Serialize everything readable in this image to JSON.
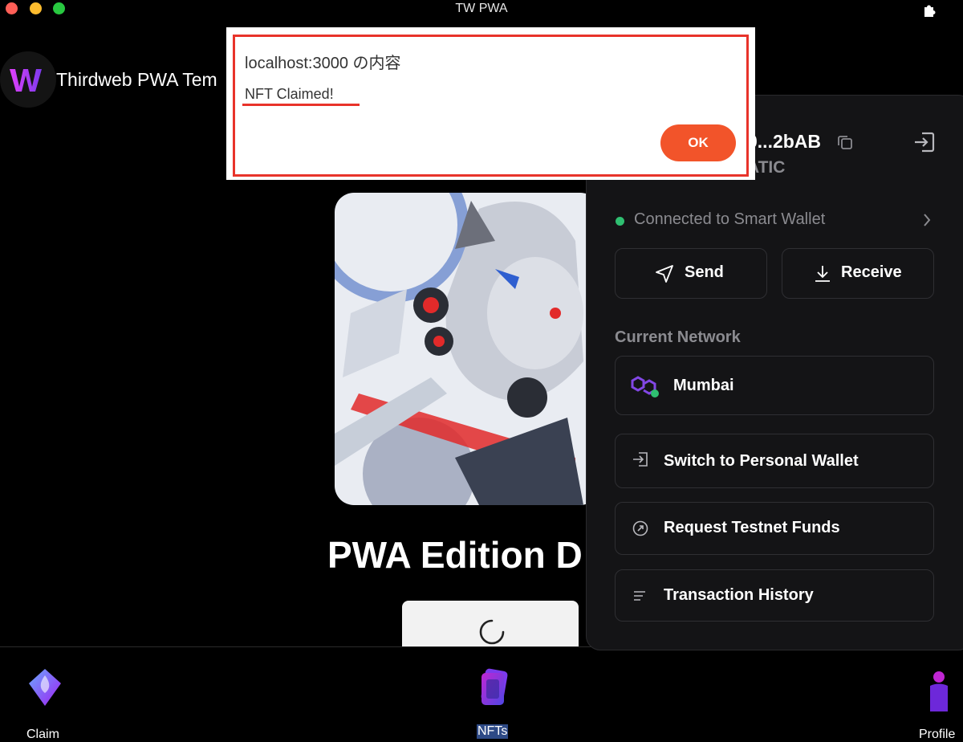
{
  "window": {
    "title": "TW PWA"
  },
  "header": {
    "app_title": "Thirdweb PWA Tem"
  },
  "main": {
    "collection_title": "PWA Edition D"
  },
  "wallet": {
    "address": "...2bAB",
    "address_prefix": "0",
    "balance": "ATIC",
    "connection_status": "Connected to Smart Wallet",
    "send_label": "Send",
    "receive_label": "Receive",
    "current_network_label": "Current Network",
    "network_name": "Mumbai",
    "switch_label": "Switch to Personal Wallet",
    "faucet_label": "Request Testnet Funds",
    "history_label": "Transaction History"
  },
  "bottom_nav": {
    "items": [
      {
        "label": "Claim",
        "icon": "claim-icon"
      },
      {
        "label": "NFTs",
        "icon": "nfts-icon"
      },
      {
        "label": "Profile",
        "icon": "profile-icon"
      }
    ]
  },
  "alert": {
    "title": "localhost:3000 の内容",
    "message": "NFT Claimed!",
    "ok_label": "OK"
  },
  "colors": {
    "accent_orange": "#f2542a",
    "highlight_red": "#e8332a",
    "connected_green": "#2fbf71",
    "panel_bg": "#141416"
  }
}
